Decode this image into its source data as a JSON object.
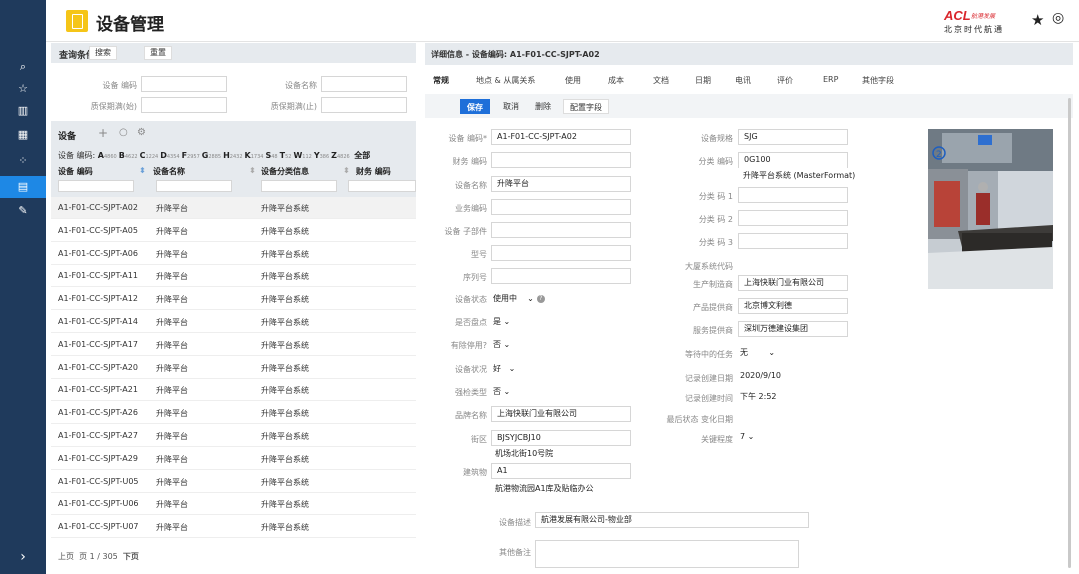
{
  "app": {
    "title": "设备管理"
  },
  "brand": {
    "name": "ACL",
    "sub": "航港发展",
    "city": "北京时代航通"
  },
  "header": {
    "star_icon": "star-icon",
    "user_icon": "user-circle-icon"
  },
  "rail": {
    "items": [
      {
        "icon": "search-icon",
        "glyph": "⌕"
      },
      {
        "icon": "star-outline-icon",
        "glyph": "☆"
      },
      {
        "icon": "building-icon",
        "glyph": "▥"
      },
      {
        "icon": "calendar-icon",
        "glyph": "▦"
      },
      {
        "icon": "grid-icon",
        "glyph": "⁘"
      },
      {
        "icon": "document-icon",
        "glyph": "▤"
      },
      {
        "icon": "wrench-icon",
        "glyph": "✎"
      }
    ],
    "expand": "›"
  },
  "query": {
    "title": "查询条件",
    "search": "搜索",
    "reset": "重置",
    "f1": "设备 编码",
    "f2": "设备名称",
    "f3": "质保期满(始)",
    "f4": "质保期满(止)"
  },
  "list": {
    "title": "设备",
    "add": "+",
    "refresh": "○",
    "settings": "⚙",
    "letters": [
      [
        "A",
        "4860"
      ],
      [
        "B",
        "4622"
      ],
      [
        "C",
        "1224"
      ],
      [
        "D",
        "4354"
      ],
      [
        "F",
        "2957"
      ],
      [
        "G",
        "2885"
      ],
      [
        "H",
        "2432"
      ],
      [
        "K",
        "1734"
      ],
      [
        "S",
        "48"
      ],
      [
        "T",
        "52"
      ],
      [
        "W",
        "112"
      ],
      [
        "Y",
        "386"
      ],
      [
        "Z",
        "4826"
      ]
    ],
    "letters_prefix": "设备 编码:",
    "letters_all": "全部",
    "col1": "设备 编码",
    "col2": "设备名称",
    "col3": "设备分类信息",
    "col4": "财务 编码",
    "rows": [
      [
        "A1-F01-CC-SJPT-A02",
        "升降平台",
        "升降平台系统"
      ],
      [
        "A1-F01-CC-SJPT-A05",
        "升降平台",
        "升降平台系统"
      ],
      [
        "A1-F01-CC-SJPT-A06",
        "升降平台",
        "升降平台系统"
      ],
      [
        "A1-F01-CC-SJPT-A11",
        "升降平台",
        "升降平台系统"
      ],
      [
        "A1-F01-CC-SJPT-A12",
        "升降平台",
        "升降平台系统"
      ],
      [
        "A1-F01-CC-SJPT-A14",
        "升降平台",
        "升降平台系统"
      ],
      [
        "A1-F01-CC-SJPT-A17",
        "升降平台",
        "升降平台系统"
      ],
      [
        "A1-F01-CC-SJPT-A20",
        "升降平台",
        "升降平台系统"
      ],
      [
        "A1-F01-CC-SJPT-A21",
        "升降平台",
        "升降平台系统"
      ],
      [
        "A1-F01-CC-SJPT-A26",
        "升降平台",
        "升降平台系统"
      ],
      [
        "A1-F01-CC-SJPT-A27",
        "升降平台",
        "升降平台系统"
      ],
      [
        "A1-F01-CC-SJPT-A29",
        "升降平台",
        "升降平台系统"
      ],
      [
        "A1-F01-CC-SJPT-U05",
        "升降平台",
        "升降平台系统"
      ],
      [
        "A1-F01-CC-SJPT-U06",
        "升降平台",
        "升降平台系统"
      ],
      [
        "A1-F01-CC-SJPT-U07",
        "升降平台",
        "升降平台系统"
      ]
    ],
    "pager": {
      "prev": "上页",
      "page": "页 1 / 305",
      "next": "下页"
    }
  },
  "detail": {
    "title": "详细信息 - 设备编码: A1-F01-CC-SJPT-A02",
    "tabs": [
      "常规",
      "地点 & 从属关系",
      "使用",
      "成本",
      "文档",
      "日期",
      "电讯",
      "评价",
      "ERP",
      "其他字段"
    ],
    "save": "保存",
    "cancel": "取消",
    "delete": "删除",
    "config": "配置字段",
    "left": [
      {
        "l": "设备 编码*",
        "v": "A1-F01-CC-SJPT-A02"
      },
      {
        "l": "财务 编码",
        "v": ""
      },
      {
        "l": "设备名称",
        "v": "升降平台"
      },
      {
        "l": "业务编码",
        "v": ""
      },
      {
        "l": "设备 子部件",
        "v": ""
      },
      {
        "l": "型号",
        "v": ""
      },
      {
        "l": "序列号",
        "v": ""
      }
    ],
    "status_l": "设备状态",
    "status_v": "使用中",
    "inv_l": "是否盘点",
    "inv_v": "是",
    "stopped_l": "有除停用?",
    "stopped_v": "否",
    "cond_l": "设备状况",
    "cond_v": "好",
    "strong_l": "强检类型",
    "strong_v": "否",
    "brand_l": "品牌名称",
    "brand_v": "上海快联门业有限公司",
    "street_l": "街区",
    "street_v": "BJSYJCBJ10",
    "street_sub": "机场北街10号院",
    "bld_l": "建筑物",
    "bld_v": "A1",
    "bld_sub": "航港物流园A1库及贴临办公",
    "spec_l": "设备规格",
    "spec_v": "SJG",
    "cls_l": "分类 编码",
    "cls_v": "0G100",
    "cls_sub": "升降平台系统 (MasterFormat)",
    "c1": "分类 码 1",
    "c2": "分类 码 2",
    "c3": "分类 码 3",
    "sys_l": "大厦系统代码",
    "mfr_l": "生产制造商",
    "mfr_v": "上海快联门业有限公司",
    "prov_l": "产品提供商",
    "prov_v": "北京博文利德",
    "svc_l": "服务提供商",
    "svc_v": "深圳万德建设集团",
    "task_l": "等待中的任务",
    "task_v": "无",
    "cdate_l": "记录创建日期",
    "cdate_v": "2020/9/10",
    "ctime_l": "记录创建时间",
    "ctime_v": "下午 2:52",
    "last_l": "最后状态 变化日期",
    "key_l": "关键程度",
    "key_v": "7",
    "desc_l": "设备描述",
    "desc_v": "航港发展有限公司-物业部",
    "note_l": "其他备注"
  }
}
